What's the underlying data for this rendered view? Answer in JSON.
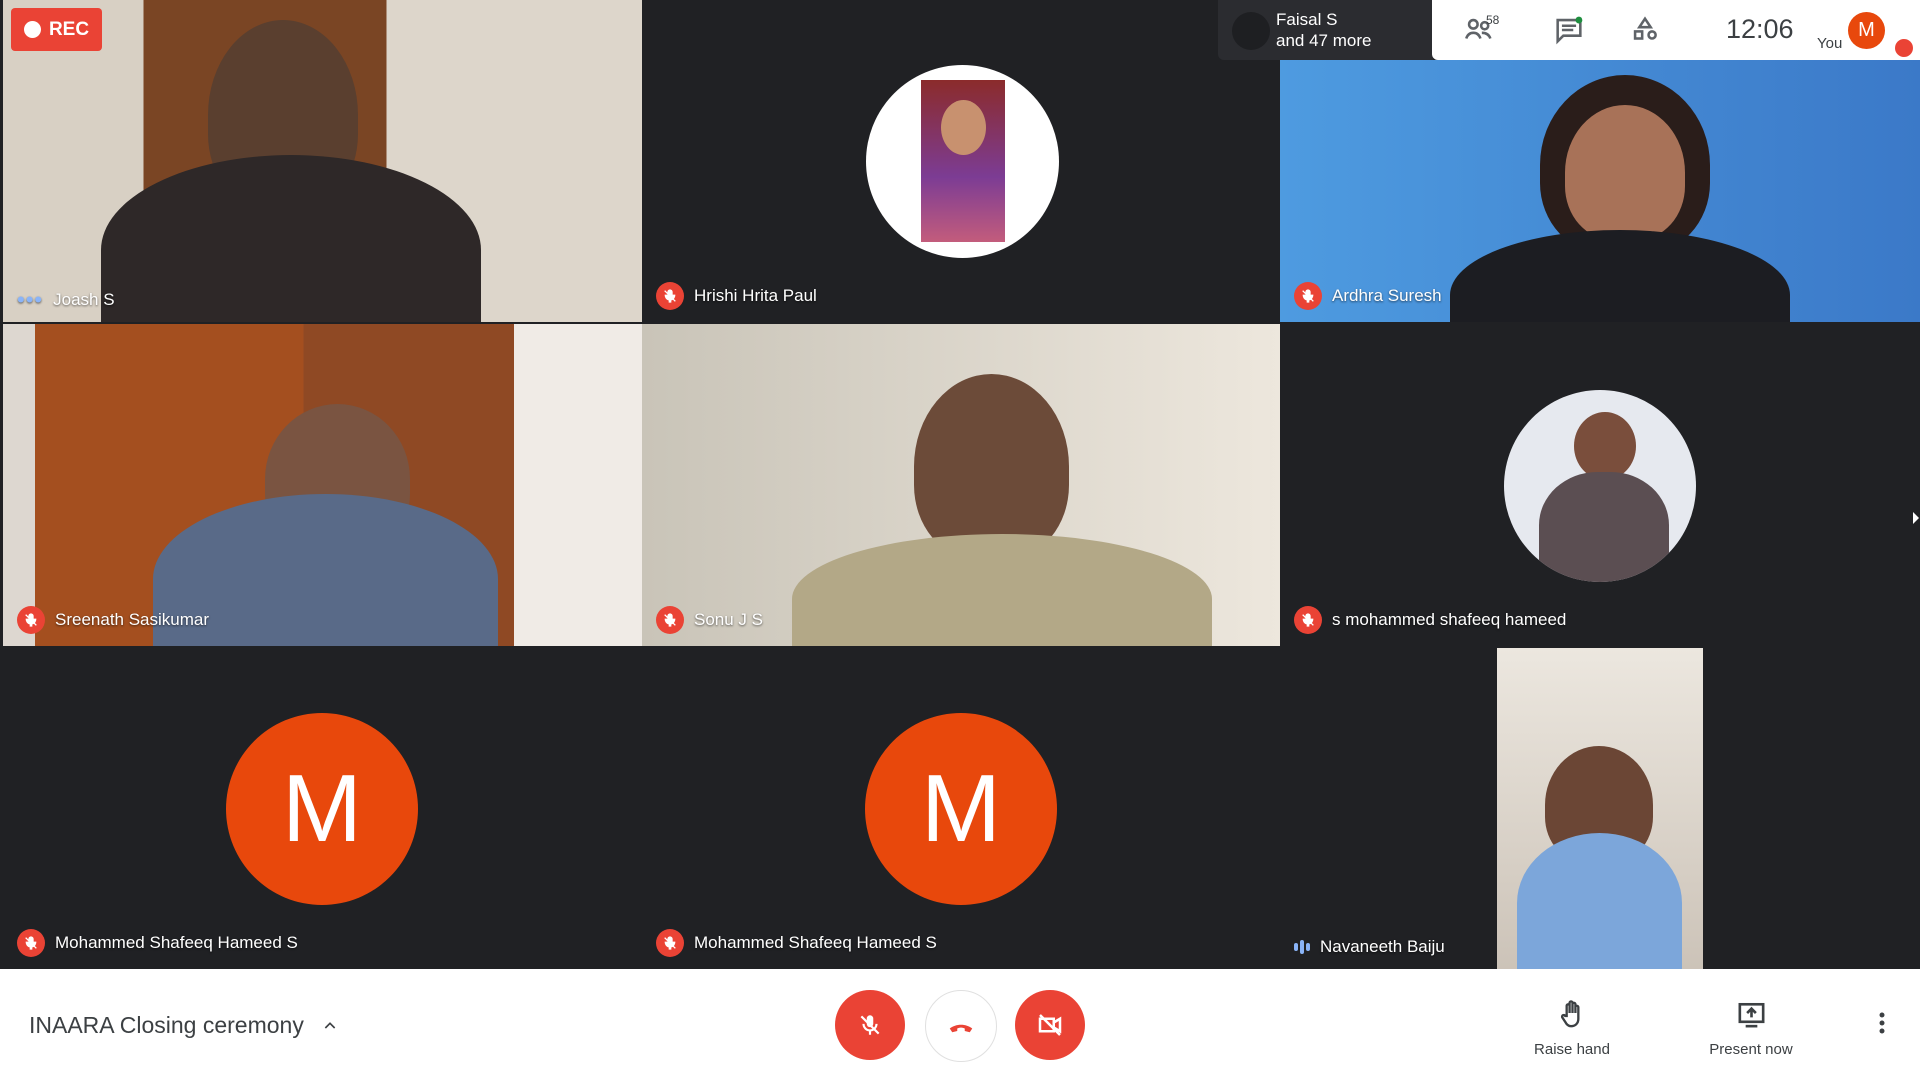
{
  "recording": {
    "label": "REC"
  },
  "speaker_chip": {
    "line1": "Faisal S",
    "line2": "and 47 more"
  },
  "top_bar": {
    "participants_count": "58",
    "time": "12:06",
    "you_label": "You",
    "avatar_letter": "M"
  },
  "participants": [
    {
      "name": "Joash S"
    },
    {
      "name": "Hrishi Hrita Paul"
    },
    {
      "name": "Ardhra Suresh"
    },
    {
      "name": "Sreenath Sasikumar"
    },
    {
      "name": "Sonu J S"
    },
    {
      "name": "s mohammed shafeeq hameed"
    },
    {
      "name": "Mohammed Shafeeq Hameed S",
      "avatar": "M"
    },
    {
      "name": "Mohammed Shafeeq Hameed S",
      "avatar": "M"
    },
    {
      "name": "Navaneeth Baiju"
    }
  ],
  "bottom_bar": {
    "meeting_title": "INAARA Closing ceremony",
    "raise_hand": "Raise hand",
    "present_now": "Present now"
  },
  "colors": {
    "mute_red": "#ea4335",
    "avatar_orange": "#e8480c",
    "dark_bg": "#202124"
  }
}
